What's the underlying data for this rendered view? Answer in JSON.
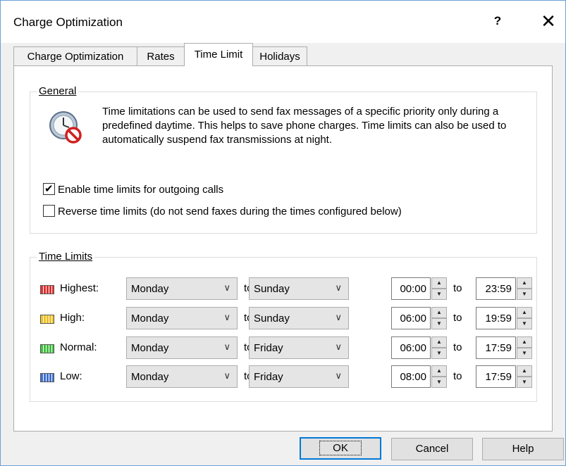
{
  "window": {
    "title": "Charge Optimization",
    "help_glyph": "?",
    "close_glyph": "✕"
  },
  "tabs": [
    {
      "label": "Charge Optimization"
    },
    {
      "label": "Rates"
    },
    {
      "label": "Time Limit"
    },
    {
      "label": "Holidays"
    }
  ],
  "active_tab": "Time Limit",
  "general": {
    "label": "General",
    "description": "Time limitations can be used to send fax messages of a specific priority only during a predefined daytime. This helps to save phone charges. Time limits can also be used to automatically suspend fax transmissions at night.",
    "enable_label": "Enable time limits for outgoing calls",
    "enable_checked": true,
    "reverse_label": "Reverse time limits (do not send faxes during the times configured below)",
    "reverse_checked": false,
    "check_glyph": "✔"
  },
  "time_limits": {
    "label": "Time Limits",
    "to_label": "to",
    "rows": [
      {
        "priority": "Highest:",
        "color": "#e03030",
        "from_day": "Monday",
        "to_day": "Sunday",
        "from_time": "00:00",
        "to_time": "23:59"
      },
      {
        "priority": "High:",
        "color": "#f0c020",
        "from_day": "Monday",
        "to_day": "Sunday",
        "from_time": "06:00",
        "to_time": "19:59"
      },
      {
        "priority": "Normal:",
        "color": "#40c040",
        "from_day": "Monday",
        "to_day": "Friday",
        "from_time": "06:00",
        "to_time": "17:59"
      },
      {
        "priority": "Low:",
        "color": "#4070d0",
        "from_day": "Monday",
        "to_day": "Friday",
        "from_time": "08:00",
        "to_time": "17:59"
      }
    ]
  },
  "buttons": {
    "ok": "OK",
    "cancel": "Cancel",
    "help": "Help"
  },
  "icons": {
    "dropdown": "chevron-down-icon",
    "spin_up": "▲",
    "spin_down": "▼",
    "dropdown_glyph": "∨"
  }
}
